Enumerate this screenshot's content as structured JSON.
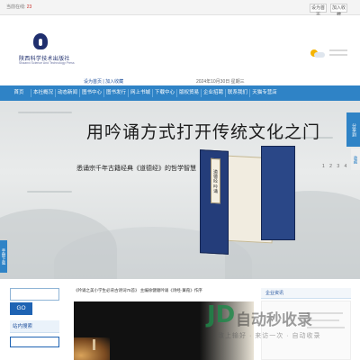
{
  "topbar": {
    "stats_label": "当前在线:",
    "stats_value": "23",
    "btn_a": "设为首页",
    "btn_b": "加入收藏"
  },
  "header": {
    "logo_cn": "陕西科学技术出版社",
    "logo_en": "Shaanxi Science And Technology Press",
    "quick_a": "设为首页",
    "quick_b": "加入收藏",
    "date": "2024年10月30日 星期三"
  },
  "nav": {
    "items": [
      "首页",
      "本社概况",
      "动态新闻",
      "图书中心",
      "图书发行",
      "网上书城",
      "下载中心",
      "版权贸易",
      "企业招聘",
      "联系我们",
      "天猫专营店"
    ]
  },
  "banner": {
    "title": "用吟诵方式打开传统文化之门",
    "subtitle": "悉诵宗千年古籍经典《道德经》的哲学智慧",
    "book_label": "道德经 吟诵",
    "dots": "1 2 3 4"
  },
  "side": {
    "right_tab": "分享到",
    "right_tab2": "收藏",
    "left_tab": "手册下载"
  },
  "search": {
    "placeholder": "",
    "go_label": "GO",
    "site_search_title": "站内搜索"
  },
  "news": {
    "marquee": "《吟诵之美小学生必背古诗词75首》  主编徐健顺吟诵《诗经·蒹葭》作序"
  },
  "right_panel": {
    "title": "企业资讯"
  },
  "watermark": {
    "logo": "JD",
    "text": "自动秒收录",
    "sub": "致上输好 · 来访一次 · 自动收录"
  }
}
